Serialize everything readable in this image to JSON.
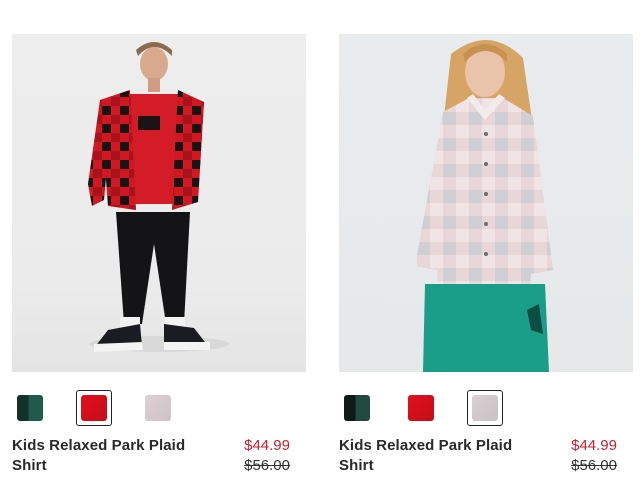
{
  "products": [
    {
      "name": "Kids Relaxed Park Plaid Shirt",
      "sale_price": "$44.99",
      "original_price": "$56.00",
      "swatches": [
        {
          "color": "#16302a",
          "accent": "#1f5a4b",
          "selected": false
        },
        {
          "color": "#e0101c",
          "accent": "#c50d18",
          "selected": true
        },
        {
          "color": "#ddd0d4",
          "accent": "#cfc3c8",
          "selected": false
        }
      ]
    },
    {
      "name": "Kids Relaxed Park Plaid Shirt",
      "sale_price": "$44.99",
      "original_price": "$56.00",
      "swatches": [
        {
          "color": "#111a18",
          "accent": "#214a40",
          "selected": false
        },
        {
          "color": "#e0101c",
          "accent": "#c50d18",
          "selected": false
        },
        {
          "color": "#d8d0d2",
          "accent": "#c9c2c5",
          "selected": true
        }
      ]
    }
  ]
}
